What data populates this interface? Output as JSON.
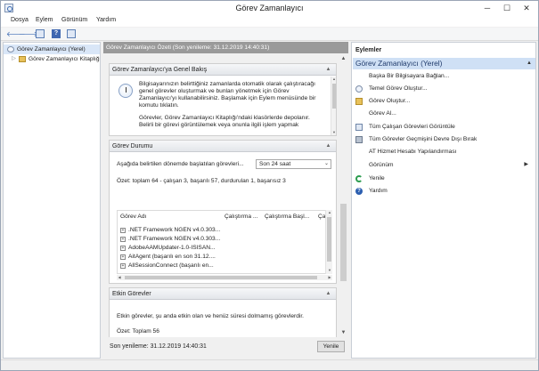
{
  "window": {
    "title": "Görev Zamanlayıcı",
    "minimize": "─",
    "maximize": "☐",
    "close": "✕"
  },
  "menu": [
    "Dosya",
    "Eylem",
    "Görünüm",
    "Yardım"
  ],
  "toolbar": {
    "back": "🡐",
    "forward": "🡒",
    "help": "?"
  },
  "tree": {
    "root": "Görev Zamanlayıcı (Yerel)",
    "child": "Görev Zamanlayıcı Kitaplığı"
  },
  "center": {
    "header": "Görev Zamanlayıcı Özeti (Son yenileme: 31.12.2019 14:40:31)",
    "overview": {
      "title": "Görev Zamanlayıcı'ya Genel Bakış",
      "text1": "Bilgisayarınızın belirttiğiniz zamanlarda otomatik olarak çalıştıracağı genel görevler oluşturmak ve bunları yönetmek için Görev Zamanlayıcı'yı kullanabilirsiniz. Başlamak için Eylem menüsünde bir komutu tıklatın.",
      "text2": "Görevler, Görev Zamanlayıcı Kitaplığı'ndaki klasörlerde depolanır. Belirli bir görevi görüntülemek veya onunla ilgili işlem yapmak"
    },
    "status": {
      "title": "Görev Durumu",
      "label": "Aşağıda belirtilen dönemde başlatılan görevleri...",
      "period": "Son 24 saat",
      "summary": "Özet: toplam 64 - çalışan 3, başarılı 57, durdurulan 1, başarısız 3",
      "columns": [
        "Görev Adı",
        "Çalıştırma ...",
        "Çalıştırma Başl...",
        "Ça"
      ],
      "rows": [
        ".NET Framework NGEN v4.0.303...",
        ".NET Framework NGEN v4.0.303...",
        "AdobeAAMUpdater-1.0-ISISAN...",
        "AitAgent (başarılı en son 31.12....",
        "AllSessionConnect (başarılı en..."
      ]
    },
    "active": {
      "title": "Etkin Görevler",
      "text": "Etkin görevler, şu anda etkin olan ve henüz süresi dolmamış görevlerdir.",
      "total": "Özet: Toplam 56"
    },
    "footer": {
      "last_refresh": "Son yenileme: 31.12.2019 14:40:31",
      "refresh_button": "Yenile"
    }
  },
  "actions": {
    "title": "Eylemler",
    "section": "Görev Zamanlayıcı (Yerel)",
    "items": [
      {
        "label": "Başka Bir Bilgisayara Bağlan...",
        "icon": "none"
      },
      {
        "label": "Temel Görev Oluştur...",
        "icon": "clock-icon"
      },
      {
        "label": "Görev Oluştur...",
        "icon": "folder-icon"
      },
      {
        "label": "Görev Al...",
        "icon": "none"
      },
      {
        "label": "Tüm Çalışan Görevleri Görüntüle",
        "icon": "list-icon"
      },
      {
        "label": "Tüm Görevler Geçmişini Devre Dışı Bırak",
        "icon": "trash-icon"
      },
      {
        "label": "AT Hizmet Hesabı Yapılandırması",
        "icon": "none"
      },
      {
        "label": "Görünüm",
        "icon": "none"
      },
      {
        "label": "Yenile",
        "icon": "refresh-icon"
      },
      {
        "label": "Yardım",
        "icon": "help-icon"
      }
    ]
  },
  "colors": {
    "selection": "#cfe0f5",
    "header_gray": "#9a9a9a",
    "accent": "#1f3a6b"
  }
}
